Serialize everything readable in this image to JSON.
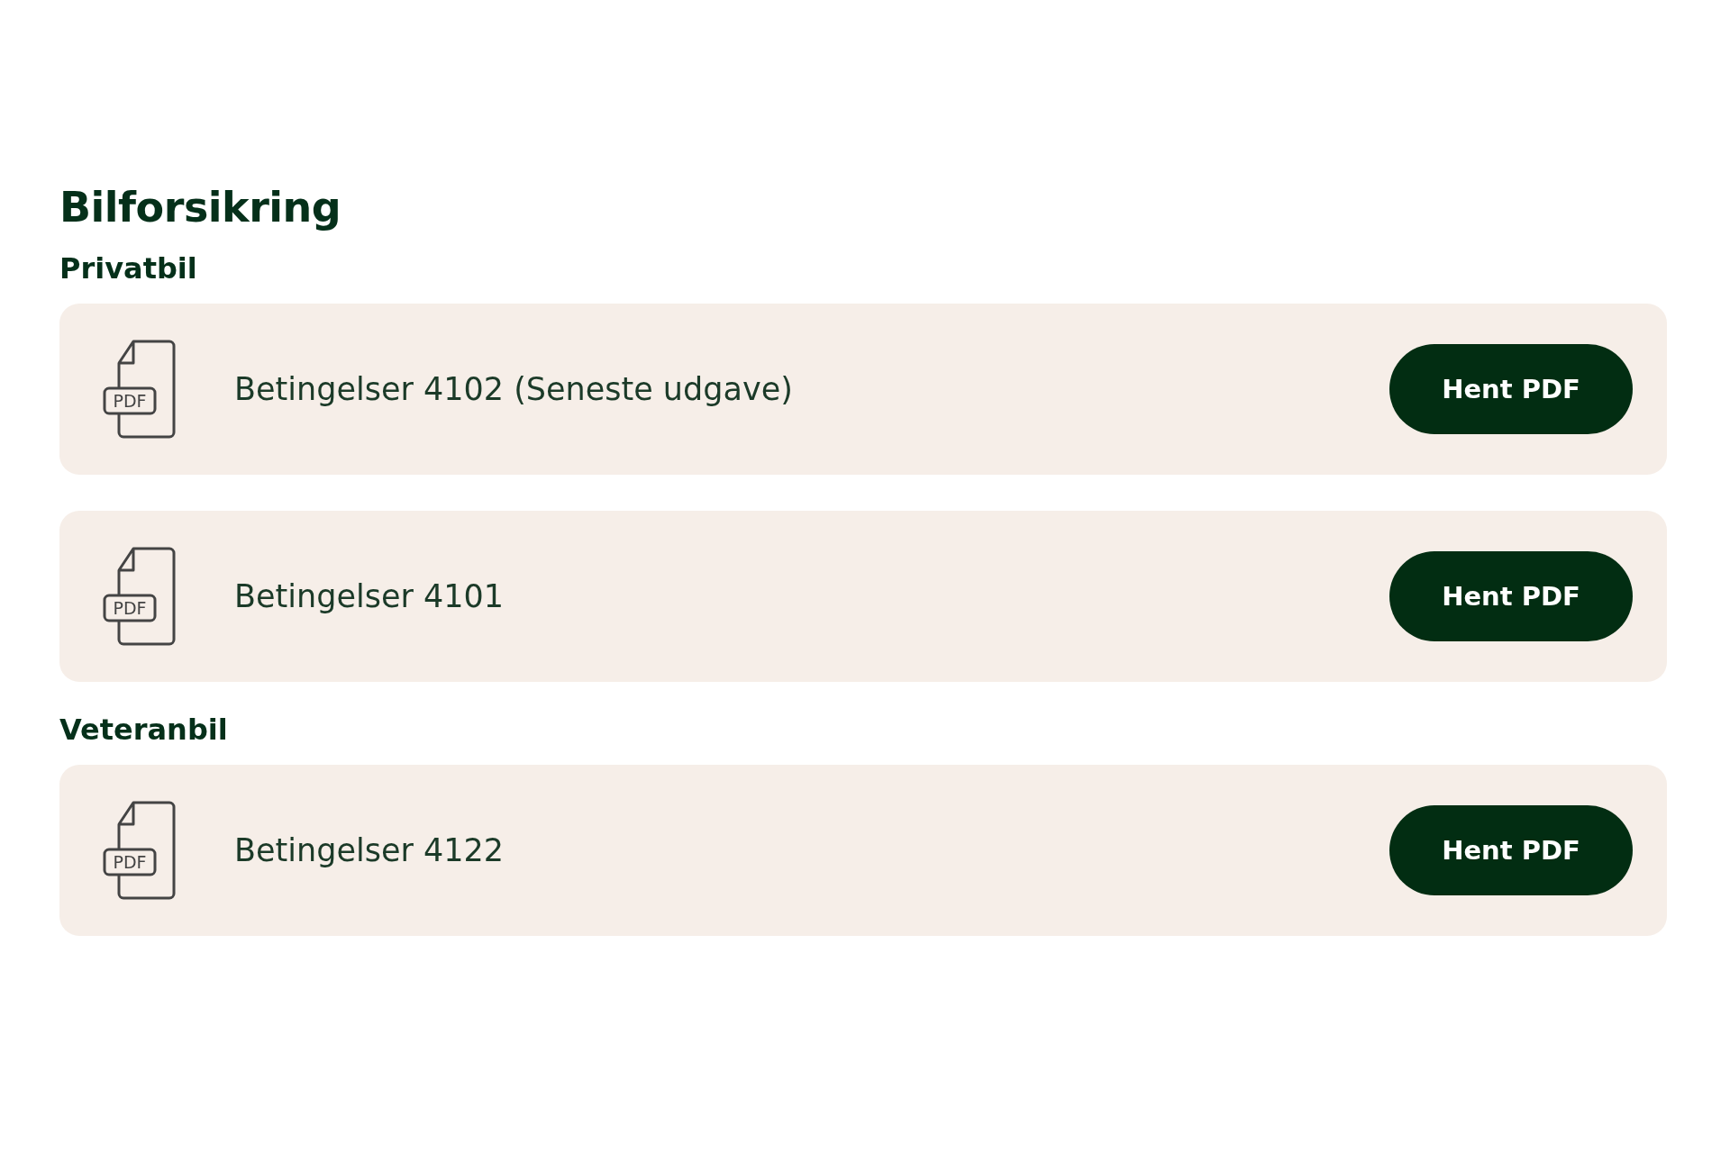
{
  "title": "Bilforsikring",
  "sections": [
    {
      "heading": "Privatbil",
      "documents": [
        {
          "icon_label": "PDF",
          "name": "Betingelser 4102 (Seneste udgave)",
          "button": "Hent PDF"
        },
        {
          "icon_label": "PDF",
          "name": "Betingelser 4101",
          "button": "Hent PDF"
        }
      ]
    },
    {
      "heading": "Veteranbil",
      "documents": [
        {
          "icon_label": "PDF",
          "name": "Betingelser 4122",
          "button": "Hent PDF"
        }
      ]
    }
  ]
}
